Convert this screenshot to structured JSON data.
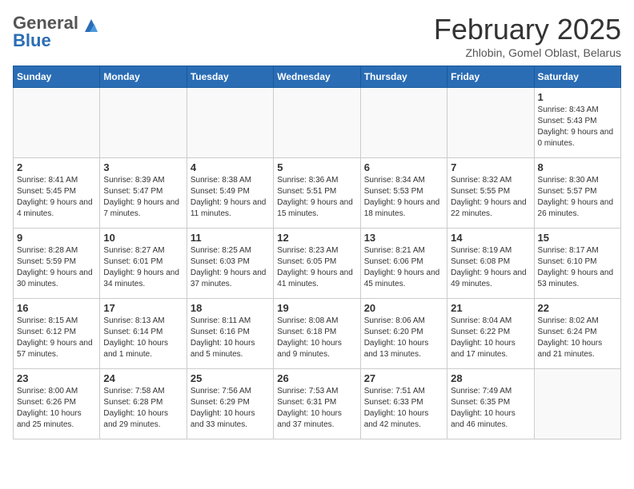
{
  "logo": {
    "general": "General",
    "blue": "Blue"
  },
  "header": {
    "month": "February 2025",
    "location": "Zhlobin, Gomel Oblast, Belarus"
  },
  "weekdays": [
    "Sunday",
    "Monday",
    "Tuesday",
    "Wednesday",
    "Thursday",
    "Friday",
    "Saturday"
  ],
  "weeks": [
    [
      {
        "day": "",
        "info": ""
      },
      {
        "day": "",
        "info": ""
      },
      {
        "day": "",
        "info": ""
      },
      {
        "day": "",
        "info": ""
      },
      {
        "day": "",
        "info": ""
      },
      {
        "day": "",
        "info": ""
      },
      {
        "day": "1",
        "info": "Sunrise: 8:43 AM\nSunset: 5:43 PM\nDaylight: 9 hours and 0 minutes."
      }
    ],
    [
      {
        "day": "2",
        "info": "Sunrise: 8:41 AM\nSunset: 5:45 PM\nDaylight: 9 hours and 4 minutes."
      },
      {
        "day": "3",
        "info": "Sunrise: 8:39 AM\nSunset: 5:47 PM\nDaylight: 9 hours and 7 minutes."
      },
      {
        "day": "4",
        "info": "Sunrise: 8:38 AM\nSunset: 5:49 PM\nDaylight: 9 hours and 11 minutes."
      },
      {
        "day": "5",
        "info": "Sunrise: 8:36 AM\nSunset: 5:51 PM\nDaylight: 9 hours and 15 minutes."
      },
      {
        "day": "6",
        "info": "Sunrise: 8:34 AM\nSunset: 5:53 PM\nDaylight: 9 hours and 18 minutes."
      },
      {
        "day": "7",
        "info": "Sunrise: 8:32 AM\nSunset: 5:55 PM\nDaylight: 9 hours and 22 minutes."
      },
      {
        "day": "8",
        "info": "Sunrise: 8:30 AM\nSunset: 5:57 PM\nDaylight: 9 hours and 26 minutes."
      }
    ],
    [
      {
        "day": "9",
        "info": "Sunrise: 8:28 AM\nSunset: 5:59 PM\nDaylight: 9 hours and 30 minutes."
      },
      {
        "day": "10",
        "info": "Sunrise: 8:27 AM\nSunset: 6:01 PM\nDaylight: 9 hours and 34 minutes."
      },
      {
        "day": "11",
        "info": "Sunrise: 8:25 AM\nSunset: 6:03 PM\nDaylight: 9 hours and 37 minutes."
      },
      {
        "day": "12",
        "info": "Sunrise: 8:23 AM\nSunset: 6:05 PM\nDaylight: 9 hours and 41 minutes."
      },
      {
        "day": "13",
        "info": "Sunrise: 8:21 AM\nSunset: 6:06 PM\nDaylight: 9 hours and 45 minutes."
      },
      {
        "day": "14",
        "info": "Sunrise: 8:19 AM\nSunset: 6:08 PM\nDaylight: 9 hours and 49 minutes."
      },
      {
        "day": "15",
        "info": "Sunrise: 8:17 AM\nSunset: 6:10 PM\nDaylight: 9 hours and 53 minutes."
      }
    ],
    [
      {
        "day": "16",
        "info": "Sunrise: 8:15 AM\nSunset: 6:12 PM\nDaylight: 9 hours and 57 minutes."
      },
      {
        "day": "17",
        "info": "Sunrise: 8:13 AM\nSunset: 6:14 PM\nDaylight: 10 hours and 1 minute."
      },
      {
        "day": "18",
        "info": "Sunrise: 8:11 AM\nSunset: 6:16 PM\nDaylight: 10 hours and 5 minutes."
      },
      {
        "day": "19",
        "info": "Sunrise: 8:08 AM\nSunset: 6:18 PM\nDaylight: 10 hours and 9 minutes."
      },
      {
        "day": "20",
        "info": "Sunrise: 8:06 AM\nSunset: 6:20 PM\nDaylight: 10 hours and 13 minutes."
      },
      {
        "day": "21",
        "info": "Sunrise: 8:04 AM\nSunset: 6:22 PM\nDaylight: 10 hours and 17 minutes."
      },
      {
        "day": "22",
        "info": "Sunrise: 8:02 AM\nSunset: 6:24 PM\nDaylight: 10 hours and 21 minutes."
      }
    ],
    [
      {
        "day": "23",
        "info": "Sunrise: 8:00 AM\nSunset: 6:26 PM\nDaylight: 10 hours and 25 minutes."
      },
      {
        "day": "24",
        "info": "Sunrise: 7:58 AM\nSunset: 6:28 PM\nDaylight: 10 hours and 29 minutes."
      },
      {
        "day": "25",
        "info": "Sunrise: 7:56 AM\nSunset: 6:29 PM\nDaylight: 10 hours and 33 minutes."
      },
      {
        "day": "26",
        "info": "Sunrise: 7:53 AM\nSunset: 6:31 PM\nDaylight: 10 hours and 37 minutes."
      },
      {
        "day": "27",
        "info": "Sunrise: 7:51 AM\nSunset: 6:33 PM\nDaylight: 10 hours and 42 minutes."
      },
      {
        "day": "28",
        "info": "Sunrise: 7:49 AM\nSunset: 6:35 PM\nDaylight: 10 hours and 46 minutes."
      },
      {
        "day": "",
        "info": ""
      }
    ]
  ]
}
